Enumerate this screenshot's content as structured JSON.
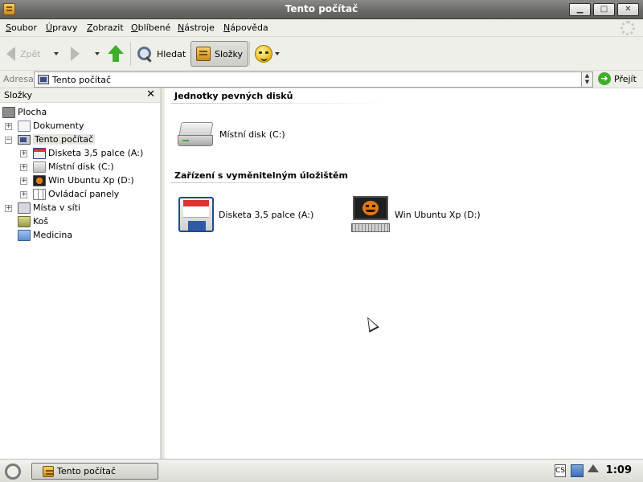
{
  "window": {
    "title": "Tento počítač"
  },
  "window_controls": {
    "minimize": "▁",
    "maximize": "□",
    "close": "✕"
  },
  "menu": {
    "items": [
      {
        "hotkey": "S",
        "rest": "oubor"
      },
      {
        "hotkey": "Ú",
        "rest": "pravy"
      },
      {
        "hotkey": "Z",
        "rest": "obrazit"
      },
      {
        "hotkey": "O",
        "rest": "blíbené"
      },
      {
        "hotkey": "N",
        "rest": "ástroje"
      },
      {
        "hotkey": "N",
        "rest": "ápověda"
      }
    ]
  },
  "toolbar": {
    "back_label": "Zpět",
    "search_label": "Hledat",
    "folders_label": "Složky"
  },
  "address": {
    "label": "Adresa",
    "value": "Tento počítač",
    "go_label": "Přejít"
  },
  "folder_pane": {
    "title": "Složky",
    "close": "✕",
    "items": [
      {
        "label": "Plocha",
        "icon": "desktop-icon"
      },
      {
        "label": "Dokumenty",
        "icon": "documents-icon"
      },
      {
        "label": "Tento počítač",
        "icon": "computer-icon"
      },
      {
        "label": "Disketa 3,5 palce (A:)",
        "icon": "floppy-icon"
      },
      {
        "label": "Místní disk (C:)",
        "icon": "hard-disk-icon"
      },
      {
        "label": "Win Ubuntu Xp (D:)",
        "icon": "cd-drive-icon"
      },
      {
        "label": "Ovládací panely",
        "icon": "control-panel-icon"
      },
      {
        "label": "Místa v síti",
        "icon": "network-icon"
      },
      {
        "label": "Koš",
        "icon": "trash-icon"
      },
      {
        "label": "Medicina",
        "icon": "folder-icon"
      }
    ]
  },
  "content": {
    "groups": [
      {
        "title": "Jednotky pevných disků",
        "items": [
          {
            "label": "Místní disk (C:)",
            "icon": "hard-disk-icon"
          }
        ]
      },
      {
        "title": "Zařízení s vyměnitelným úložištěm",
        "items": [
          {
            "label": "Disketa 3,5 palce (A:)",
            "icon": "floppy-icon"
          },
          {
            "label": "Win Ubuntu Xp (D:)",
            "icon": "cd-drive-icon"
          }
        ]
      }
    ]
  },
  "taskbar": {
    "task_label": "Tento počítač",
    "clock": "1:09",
    "tray_cs": "CS"
  },
  "colors": {
    "titlebar": "#6a6a67",
    "chrome": "#efefea",
    "content_bg": "#ffffff",
    "accent_green": "#3fae2a"
  }
}
